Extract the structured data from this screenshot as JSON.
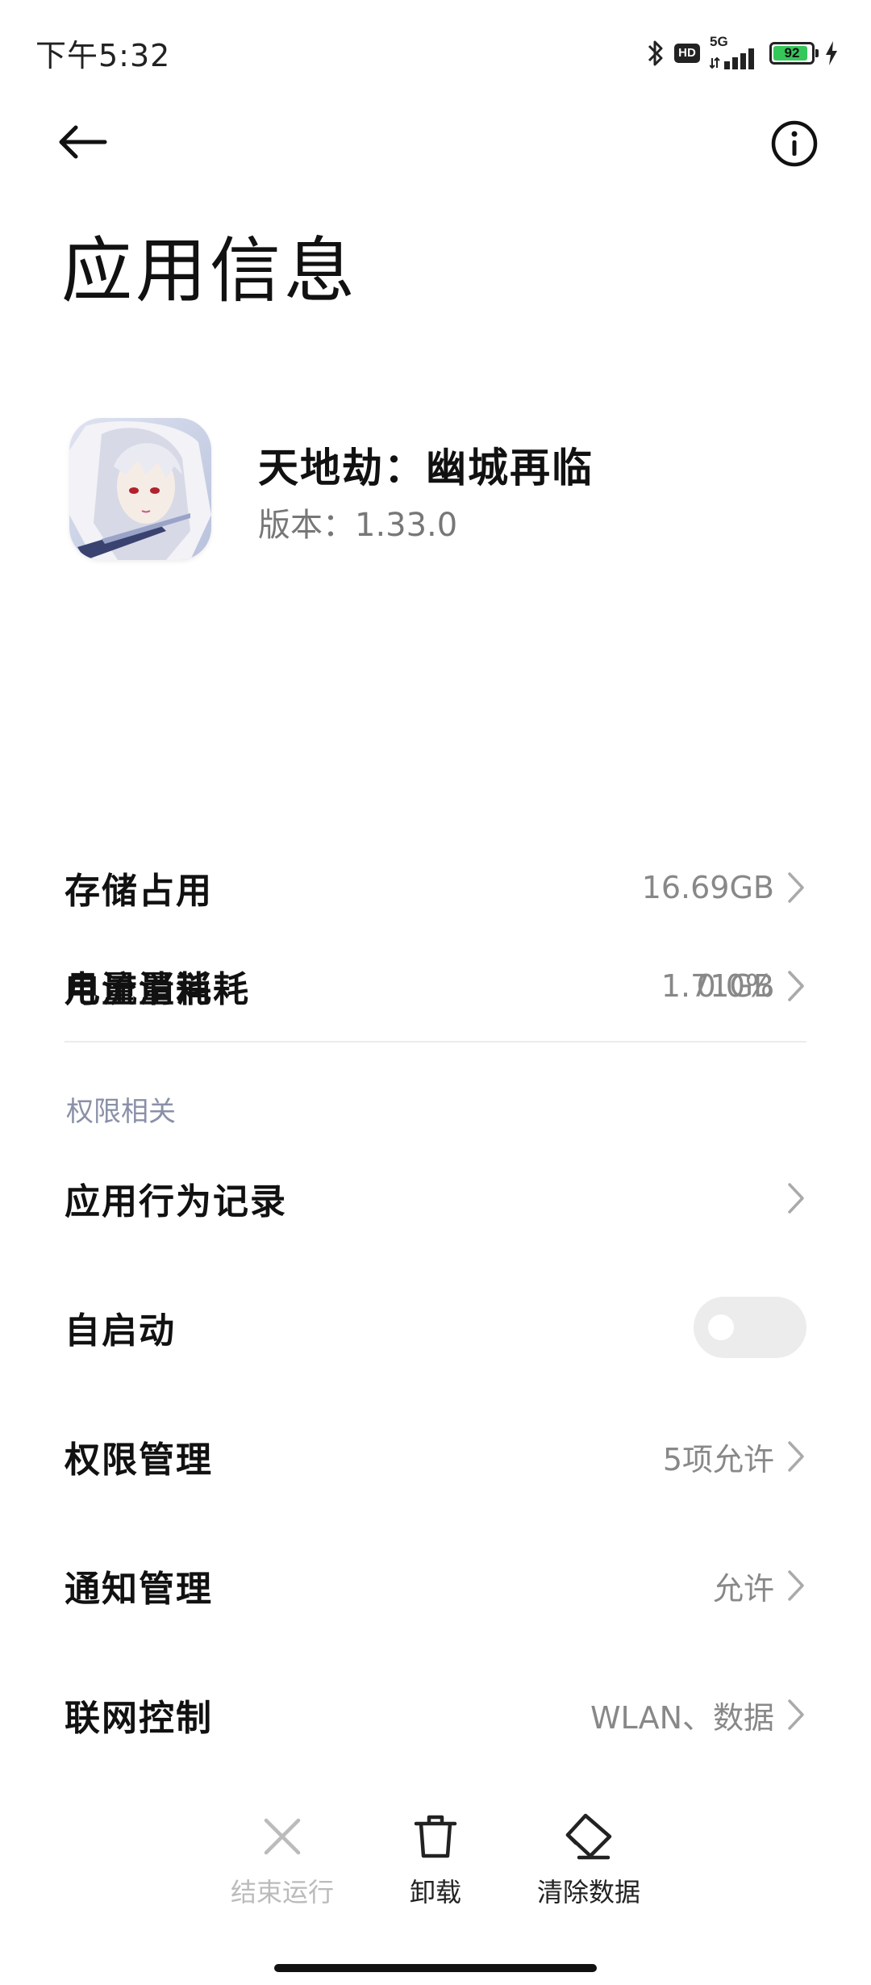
{
  "status_bar": {
    "time": "下午5:32",
    "icons": [
      "bluetooth-icon",
      "hd-icon",
      "signal-icon",
      "battery-icon",
      "charging-icon"
    ],
    "hd": "HD",
    "network_type": "5G",
    "battery_level": "92",
    "battery_fraction": 0.92,
    "battery_color": "#35c75a"
  },
  "nav": {
    "back_icon": "back-arrow-icon",
    "info_icon": "info-icon"
  },
  "page_title": "应用信息",
  "app": {
    "name": "天地劫：幽城再临",
    "version": "版本：1.33.0",
    "icon": "app-icon"
  },
  "usage_rows": [
    {
      "label": "存储占用",
      "value": "16.69GB"
    },
    {
      "label": "月流量消耗",
      "value": "1.71GB"
    },
    {
      "label": "电量消耗",
      "value": "0.0%"
    }
  ],
  "permissions": {
    "section_title": "权限相关",
    "rows": [
      {
        "label": "应用行为记录",
        "value": ""
      },
      {
        "label": "自启动",
        "toggle": false
      },
      {
        "label": "权限管理",
        "value": "5项允许"
      },
      {
        "label": "通知管理",
        "value": "允许"
      },
      {
        "label": "联网控制",
        "value": "WLAN、数据"
      }
    ]
  },
  "actions": [
    {
      "label": "结束运行",
      "icon": "close-icon",
      "enabled": false
    },
    {
      "label": "卸载",
      "icon": "trash-icon",
      "enabled": true
    },
    {
      "label": "清除数据",
      "icon": "eraser-icon",
      "enabled": true
    }
  ],
  "colors": {
    "accent_section": "#8a90a8",
    "value_gray": "#888888",
    "disabled_gray": "#bbbbbb"
  }
}
